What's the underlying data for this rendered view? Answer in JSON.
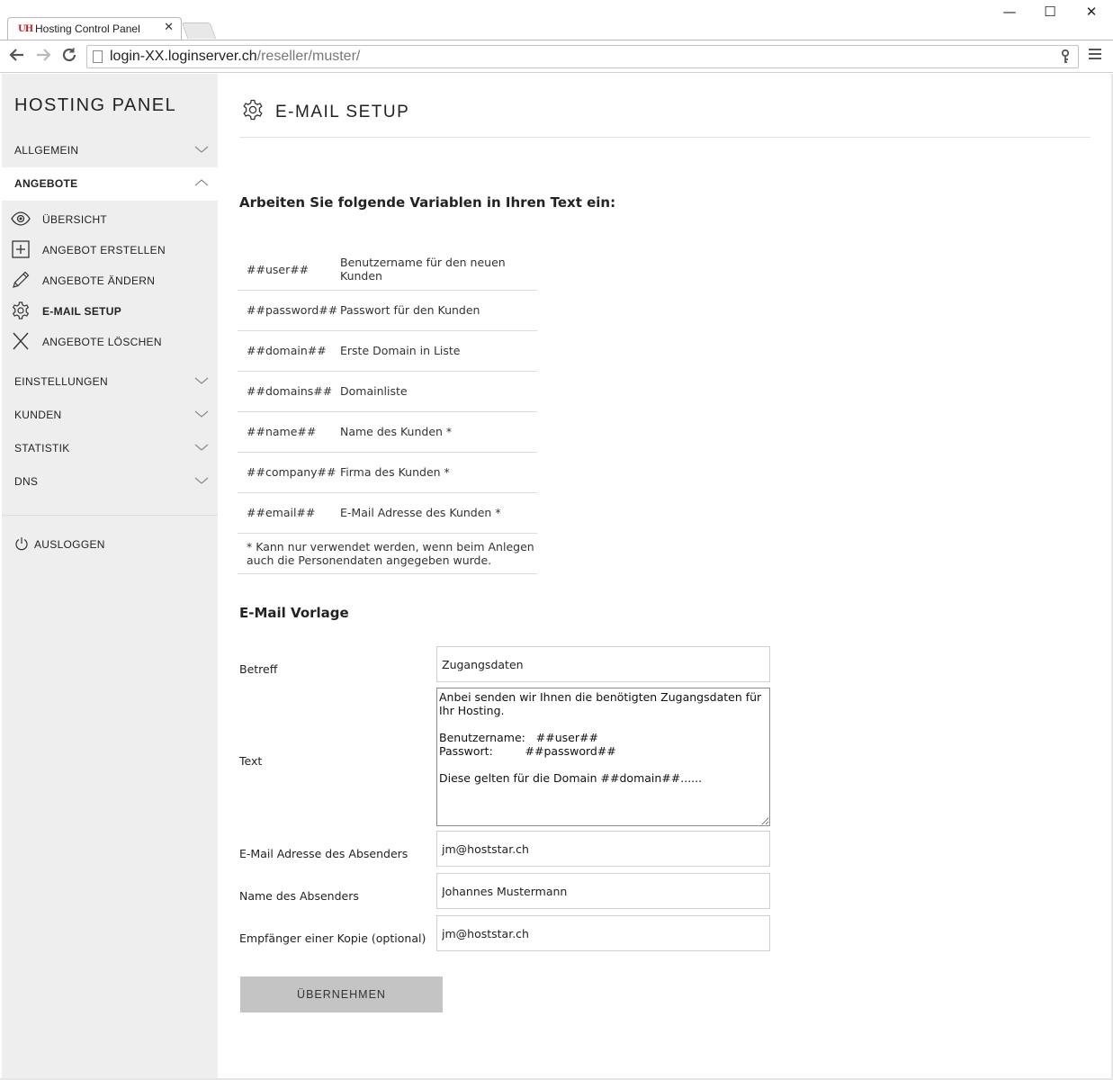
{
  "browser": {
    "tab_title": "Hosting Control Panel",
    "tab_close": "✕",
    "favicon_text": "UH",
    "url_host": "login-XX.loginserver.ch",
    "url_path": "/reseller/muster/",
    "window_minimize": "—",
    "window_maximize": "☐",
    "window_close": "✕"
  },
  "sidebar": {
    "brand": "HOSTING PANEL",
    "sections": [
      {
        "label": "ALLGEMEIN",
        "expanded": false
      },
      {
        "label": "ANGEBOTE",
        "expanded": true
      },
      {
        "label": "EINSTELLUNGEN",
        "expanded": false
      },
      {
        "label": "KUNDEN",
        "expanded": false
      },
      {
        "label": "STATISTIK",
        "expanded": false
      },
      {
        "label": "DNS",
        "expanded": false
      }
    ],
    "angebote_items": [
      {
        "label": "ÜBERSICHT",
        "icon": "eye-icon"
      },
      {
        "label": "ANGEBOT ERSTELLEN",
        "icon": "plus-box-icon"
      },
      {
        "label": "ANGEBOTE ÄNDERN",
        "icon": "pencil-icon"
      },
      {
        "label": "E-MAIL SETUP",
        "icon": "gear-icon",
        "current": true
      },
      {
        "label": "ANGEBOTE LÖSCHEN",
        "icon": "close-icon"
      }
    ],
    "logout_label": "AUSLOGGEN"
  },
  "main": {
    "title": "E-MAIL SETUP",
    "intro": "Arbeiten Sie folgende Variablen in Ihren Text ein:",
    "variables": [
      {
        "key": "##user##",
        "desc": "Benutzername für den neuen Kunden"
      },
      {
        "key": "##password##",
        "desc": "Passwort für den Kunden"
      },
      {
        "key": "##domain##",
        "desc": "Erste Domain in Liste"
      },
      {
        "key": "##domains##",
        "desc": "Domainliste"
      },
      {
        "key": "##name##",
        "desc": "Name des Kunden *"
      },
      {
        "key": "##company##",
        "desc": "Firma des Kunden *"
      },
      {
        "key": "##email##",
        "desc": "E-Mail Adresse des Kunden *"
      }
    ],
    "variables_note": "* Kann nur verwendet werden, wenn beim Anlegen auch die Personendaten angegeben wurde.",
    "template_title": "E-Mail Vorlage",
    "form": {
      "subject_label": "Betreff",
      "subject_value": "Zugangsdaten",
      "text_label": "Text",
      "text_value": "Anbei senden wir Ihnen die benötigten Zugangsdaten für Ihr Hosting.\n\nBenutzername:   ##user##\nPasswort:         ##password##\n\nDiese gelten für die Domain ##domain##......",
      "sender_email_label": "E-Mail Adresse des Absenders",
      "sender_email_value": "jm@hoststar.ch",
      "sender_name_label": "Name des Absenders",
      "sender_name_value": "Johannes Mustermann",
      "cc_label": "Empfänger einer Kopie (optional)",
      "cc_value": "jm@hoststar.ch",
      "submit_label": "ÜBERNEHMEN"
    }
  }
}
